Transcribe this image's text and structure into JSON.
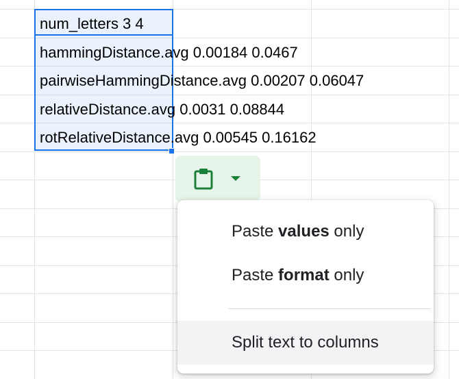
{
  "sheet": {
    "cells": [
      "num_letters 3 4",
      "hammingDistance.avg 0.00184 0.0467",
      "pairwiseHammingDistance.avg 0.00207 0.06047",
      "relativeDistance.avg 0.0031 0.08844",
      "rotRelativeDistance.avg 0.00545 0.16162"
    ]
  },
  "paste_chip": {
    "icon": "clipboard-icon",
    "dropdown_icon": "chevron-down-icon",
    "icon_color": "#188038",
    "background": "#e6f4ea"
  },
  "paste_menu": {
    "items": [
      {
        "prefix": "Paste ",
        "strong": "values",
        "suffix": " only"
      },
      {
        "prefix": "Paste ",
        "strong": "format",
        "suffix": " only"
      },
      {
        "label": "Split text to columns"
      }
    ]
  },
  "colors": {
    "selection": "#1a73e8",
    "gridline": "#e1e3e6",
    "menu_hover": "#f1f3f4"
  }
}
